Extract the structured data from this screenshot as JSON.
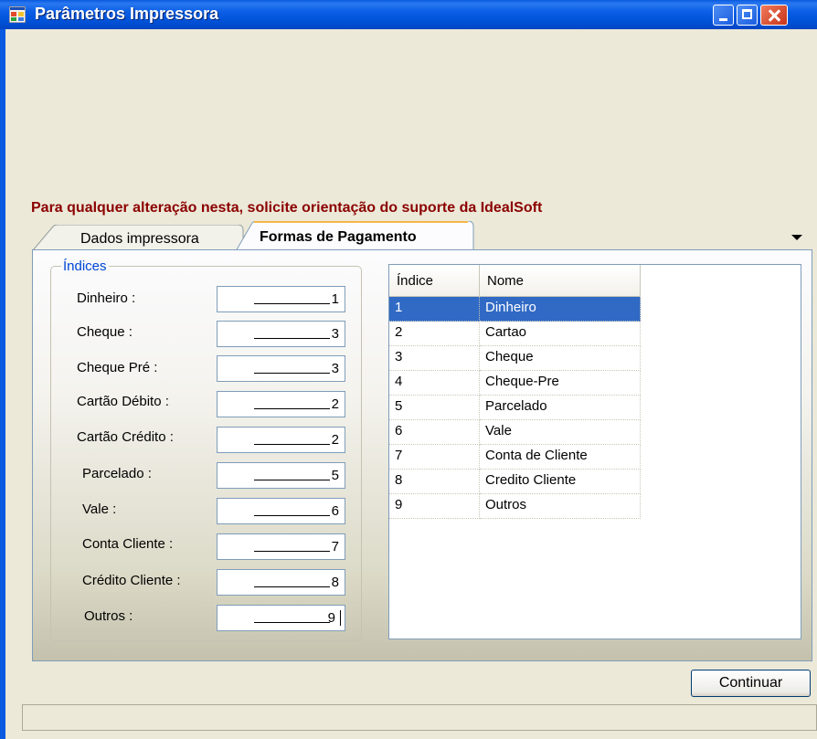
{
  "window": {
    "title": "Parâmetros Impressora"
  },
  "warning": "Para qualquer alteração nesta, solicite orientação do suporte da IdealSoft",
  "tabs": [
    {
      "label": "Dados impressora",
      "active": false
    },
    {
      "label": "Formas de Pagamento",
      "active": true
    }
  ],
  "indices_group": {
    "title": "Índices",
    "fields": [
      {
        "label": "Dinheiro :",
        "value": "1"
      },
      {
        "label": "Cheque :",
        "value": "3"
      },
      {
        "label": "Cheque Pré :",
        "value": "3"
      },
      {
        "label": "Cartão Débito :",
        "value": "2"
      },
      {
        "label": "Cartão Crédito :",
        "value": "2"
      },
      {
        "label": "Parcelado :",
        "value": "5"
      },
      {
        "label": "Vale :",
        "value": "6"
      },
      {
        "label": "Conta Cliente :",
        "value": "7"
      },
      {
        "label": "Crédito Cliente :",
        "value": "8"
      },
      {
        "label": "Outros :",
        "value": "9"
      }
    ]
  },
  "grid": {
    "columns": [
      "Índice",
      "Nome"
    ],
    "rows": [
      [
        "1",
        "Dinheiro"
      ],
      [
        "2",
        "Cartao"
      ],
      [
        "3",
        "Cheque"
      ],
      [
        "4",
        "Cheque-Pre"
      ],
      [
        "5",
        "Parcelado"
      ],
      [
        "6",
        "Vale"
      ],
      [
        "7",
        "Conta de Cliente"
      ],
      [
        "8",
        "Credito Cliente"
      ],
      [
        "9",
        "Outros"
      ]
    ],
    "selected_row": 0
  },
  "buttons": {
    "continue_label": "Continuar"
  },
  "colors": {
    "titlebar": "#0b5ee6",
    "warning": "#8b0000",
    "group_title": "#0046d5",
    "selection": "#316ac5"
  }
}
